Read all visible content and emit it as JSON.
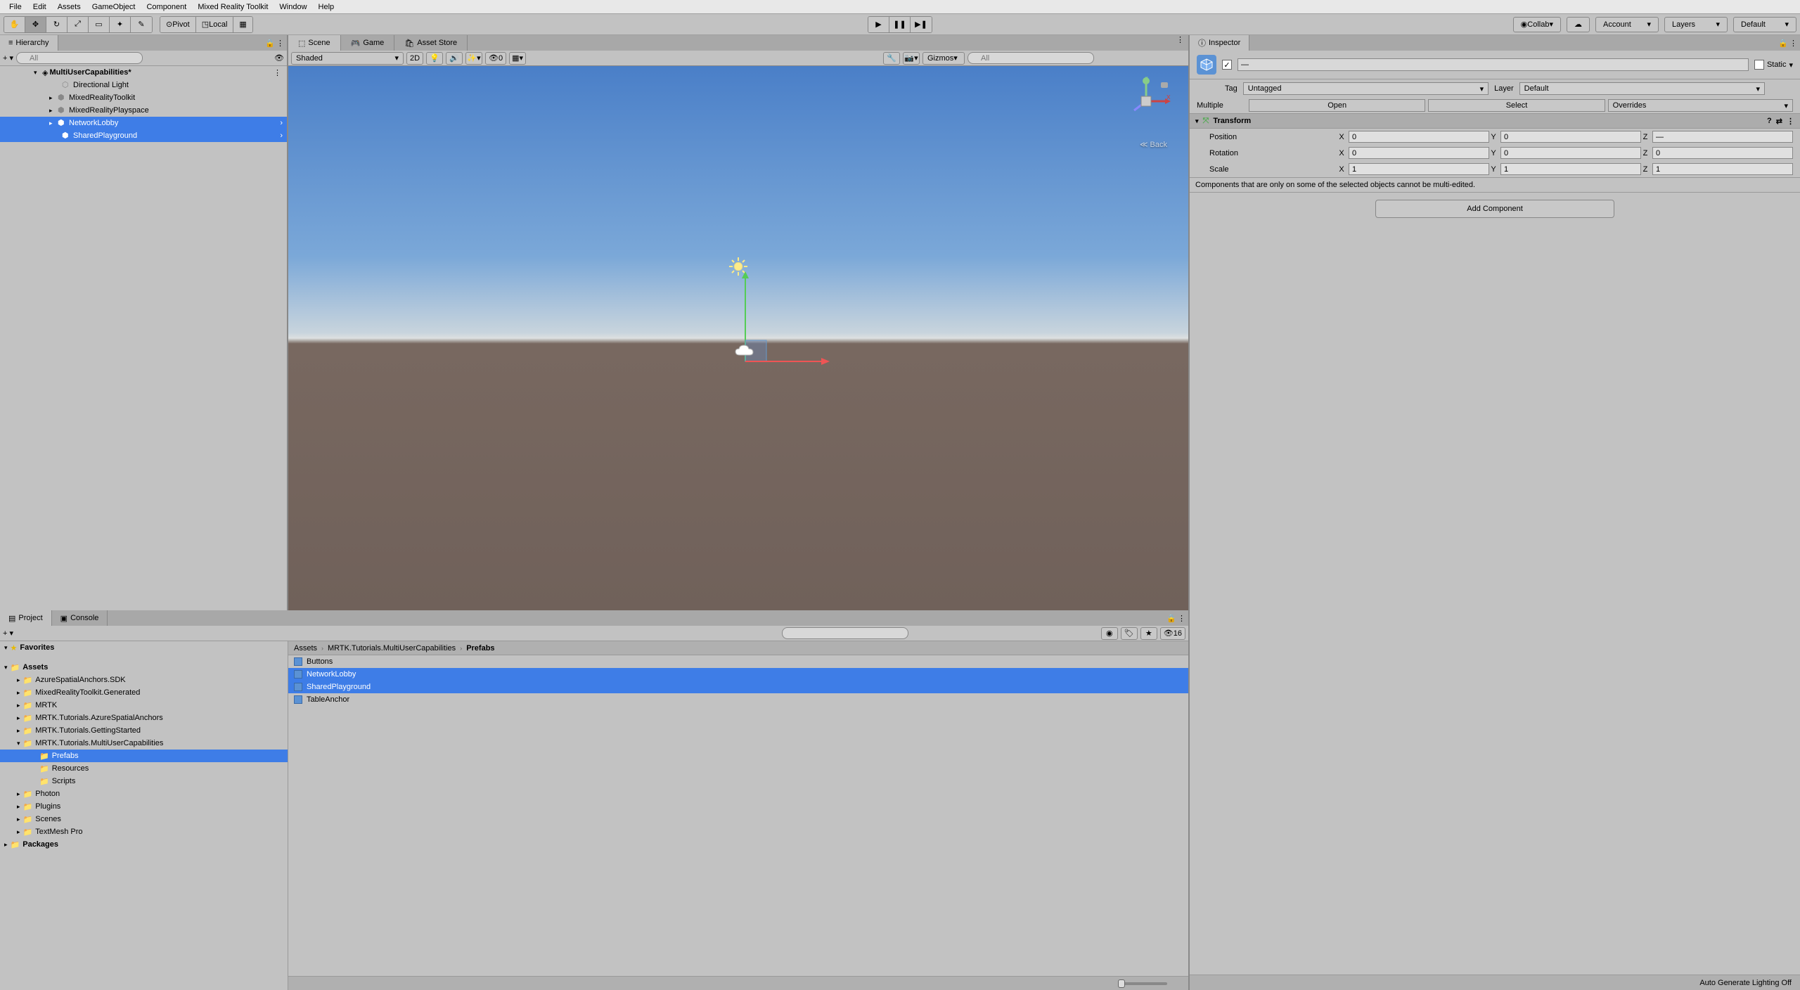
{
  "menu": [
    "File",
    "Edit",
    "Assets",
    "GameObject",
    "Component",
    "Mixed Reality Toolkit",
    "Window",
    "Help"
  ],
  "toolbar": {
    "pivot": "Pivot",
    "local": "Local",
    "collab": "Collab",
    "account": "Account",
    "layers": "Layers",
    "layout": "Default"
  },
  "hierarchy": {
    "title": "Hierarchy",
    "search_ph": "All",
    "scene": "MultiUserCapabilities*",
    "items": [
      "Directional Light",
      "MixedRealityToolkit",
      "MixedRealityPlayspace",
      "NetworkLobby",
      "SharedPlayground"
    ]
  },
  "scene_tabs": {
    "scene": "Scene",
    "game": "Game",
    "asset": "Asset Store"
  },
  "scene_toolbar": {
    "shaded": "Shaded",
    "d2": "2D",
    "zero": "0",
    "gizmos": "Gizmos",
    "search_ph": "All"
  },
  "back_label": "Back",
  "inspector": {
    "title": "Inspector",
    "dash": "—",
    "static": "Static",
    "tag_label": "Tag",
    "tag": "Untagged",
    "layer_label": "Layer",
    "layer": "Default",
    "multiple": "Multiple",
    "open": "Open",
    "select": "Select",
    "overrides": "Overrides",
    "transform": "Transform",
    "position": "Position",
    "rotation": "Rotation",
    "scale": "Scale",
    "x": "X",
    "y": "Y",
    "z": "Z",
    "pos_x": "0",
    "pos_y": "0",
    "pos_z": "",
    "rot_x": "0",
    "rot_y": "0",
    "rot_z": "0",
    "scl_x": "1",
    "scl_y": "1",
    "scl_z": "1",
    "dash_field": "—",
    "info": "Components that are only on some of the selected objects cannot be multi-edited.",
    "add_component": "Add Component"
  },
  "project": {
    "title": "Project",
    "console": "Console",
    "slider_val": "16",
    "favorites": "Favorites",
    "assets": "Assets",
    "packages": "Packages",
    "tree": [
      "AzureSpatialAnchors.SDK",
      "MixedRealityToolkit.Generated",
      "MRTK",
      "MRTK.Tutorials.AzureSpatialAnchors",
      "MRTK.Tutorials.GettingStarted",
      "MRTK.Tutorials.MultiUserCapabilities",
      "Prefabs",
      "Resources",
      "Scripts",
      "Photon",
      "Plugins",
      "Scenes",
      "TextMesh Pro"
    ],
    "breadcrumb": [
      "Assets",
      "MRTK.Tutorials.MultiUserCapabilities",
      "Prefabs"
    ],
    "list": [
      "Buttons",
      "NetworkLobby",
      "SharedPlayground",
      "TableAnchor"
    ]
  },
  "status": "Auto Generate Lighting Off"
}
